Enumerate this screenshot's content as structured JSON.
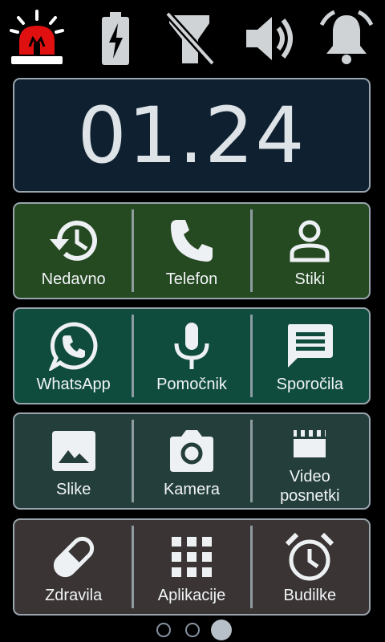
{
  "status_bar": {
    "icons": [
      "alarm-light-icon",
      "battery-charging-icon",
      "flashlight-off-icon",
      "volume-icon",
      "bell-icon"
    ]
  },
  "clock": {
    "time": "01.24"
  },
  "rows": [
    {
      "color": "#254a22",
      "tiles": [
        {
          "label": "Nedavno",
          "icon": "history-icon"
        },
        {
          "label": "Telefon",
          "icon": "phone-icon"
        },
        {
          "label": "Stiki",
          "icon": "contact-icon"
        }
      ]
    },
    {
      "color": "#0f4c3e",
      "tiles": [
        {
          "label": "WhatsApp",
          "icon": "whatsapp-icon"
        },
        {
          "label": "Pomočnik",
          "icon": "microphone-icon"
        },
        {
          "label": "Sporočila",
          "icon": "message-icon"
        }
      ]
    },
    {
      "color": "#243f3b",
      "tiles": [
        {
          "label": "Slike",
          "icon": "image-icon"
        },
        {
          "label": "Kamera",
          "icon": "camera-icon"
        },
        {
          "label": "Video\nposnetki",
          "label_line1": "Video",
          "label_line2": "posnetki",
          "icon": "video-clip-icon"
        }
      ]
    },
    {
      "color": "#3a3534",
      "tiles": [
        {
          "label": "Zdravila",
          "icon": "pill-icon"
        },
        {
          "label": "Aplikacije",
          "icon": "apps-grid-icon"
        },
        {
          "label": "Budilke",
          "icon": "alarm-clock-icon"
        }
      ]
    }
  ],
  "pager": {
    "pages": 3,
    "current": 3
  },
  "colors": {
    "tile_border": "#9aa5ad",
    "clock_bg": "#0f2131",
    "alarm_red": "#e01010"
  }
}
